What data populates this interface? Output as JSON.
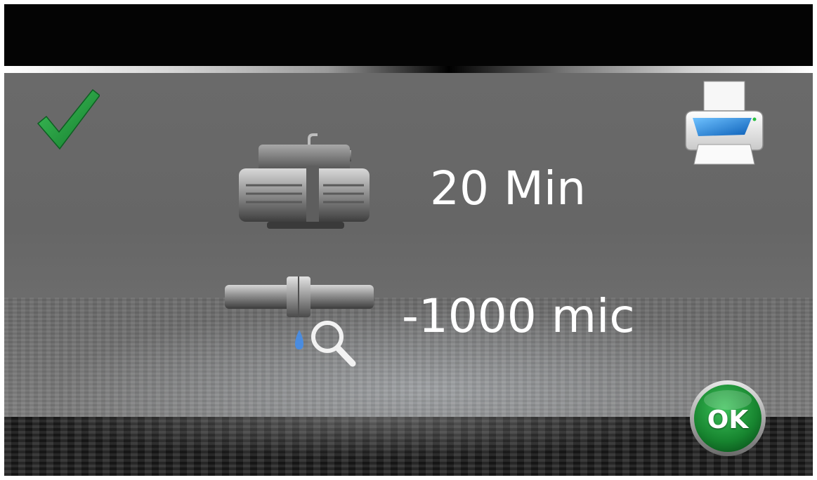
{
  "status": {
    "icon": "checkmark-icon",
    "color": "#1f9a3a"
  },
  "toolbar": {
    "print_icon": "printer-icon"
  },
  "readings": [
    {
      "icon": "vacuum-pump-icon",
      "value": "20 Min"
    },
    {
      "icon": "pipe-leak-search-icon",
      "value": "-1000 mic"
    }
  ],
  "actions": {
    "ok_label": "OK",
    "ok_color": "#1a8a33"
  },
  "colors": {
    "panel": "#6a6a6a",
    "header": "#040404",
    "text": "#ffffff"
  }
}
